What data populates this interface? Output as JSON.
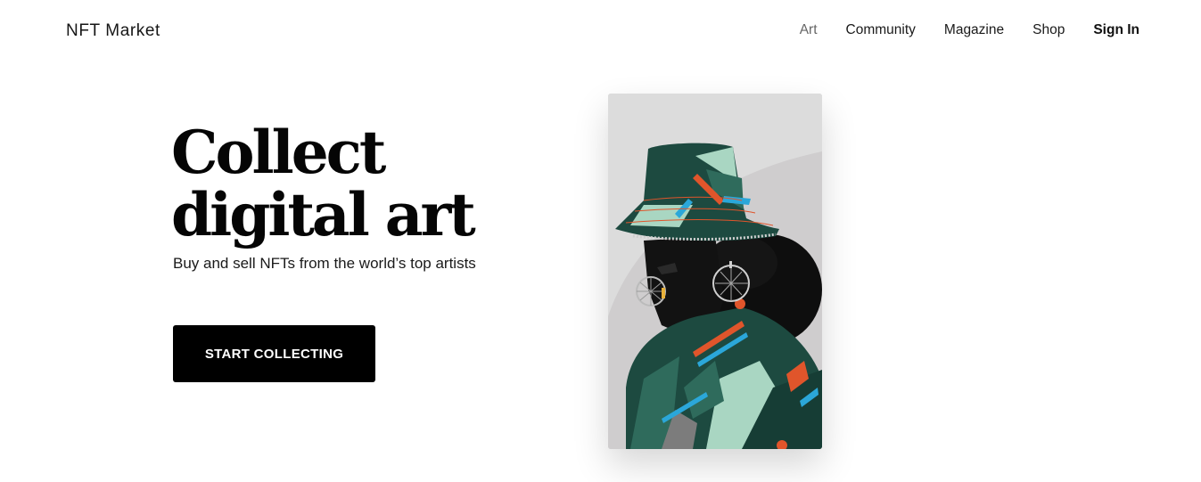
{
  "header": {
    "brand": "NFT Market",
    "nav": [
      {
        "label": "Art"
      },
      {
        "label": "Community"
      },
      {
        "label": "Magazine"
      },
      {
        "label": "Shop"
      },
      {
        "label": "Sign In"
      }
    ]
  },
  "hero": {
    "title_line1": "Collect",
    "title_line2": "digital art",
    "subtitle": "Buy and sell NFTs from the world’s top artists",
    "cta_label": "START COLLECTING"
  },
  "artwork": {
    "description_icon": "portrait-artwork",
    "colors": {
      "background": "#dcdcdc",
      "teal_dark": "#1d4a40",
      "teal_mid": "#2f6b5c",
      "mint": "#a9d6c2",
      "orange": "#e0552b",
      "blue": "#2ba7d9",
      "skin": "#111111"
    }
  },
  "colors": {
    "accent": "#000000",
    "text": "#111111",
    "nav_active": "#666666"
  }
}
